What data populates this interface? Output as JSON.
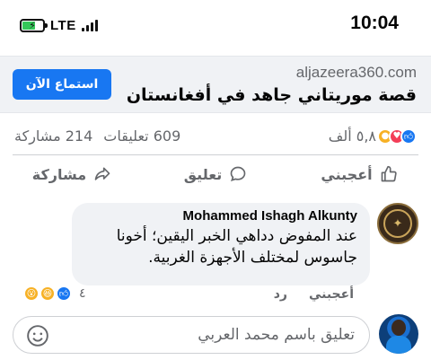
{
  "status_bar": {
    "time": "10:04",
    "network": "LTE",
    "battery_icon": "battery-charging-icon",
    "signal_icon": "signal-bars-icon"
  },
  "link_preview": {
    "domain": "aljazeera360.com",
    "title": "قصة موريتاني جاهد في أفغانستان",
    "button_label": "استماع الآن",
    "button_color": "#1877f2"
  },
  "post_stats": {
    "reactions_count": "٥,٨ ألف",
    "comments": "609 تعليقات",
    "shares": "214 مشاركة"
  },
  "actions": {
    "like": "أعجبني",
    "comment": "تعليق",
    "share": "مشاركة"
  },
  "comment": {
    "author": "Mohammed Ishagh Alkunty",
    "line1": "عند المفوض دداهي الخبر اليقين؛ أخونا",
    "line2": "جاسوس لمختلف الأجهزة الغربية.",
    "like_label": "أعجبني",
    "reply_label": "رد",
    "reaction_count": "٤"
  },
  "composer": {
    "placeholder": "تعليق باسم محمد العربي"
  },
  "colors": {
    "accent": "#1877f2",
    "secondary_text": "#65676b",
    "bubble": "#f0f2f5"
  }
}
